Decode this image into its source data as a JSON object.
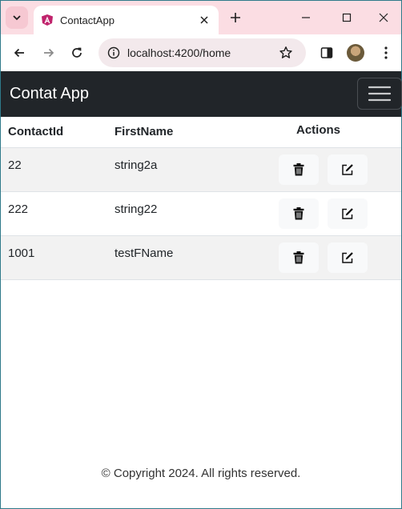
{
  "browser": {
    "tab_title": "ContactApp",
    "url": "localhost:4200/home"
  },
  "app": {
    "brand": "Contat App"
  },
  "table": {
    "headers": [
      "ContactId",
      "FirstName",
      "Actions"
    ],
    "rows": [
      {
        "id": "22",
        "first_name": "string2a"
      },
      {
        "id": "222",
        "first_name": "string22"
      },
      {
        "id": "1001",
        "first_name": "testFName"
      }
    ]
  },
  "icons": {
    "delete": "trash-icon",
    "edit": "pencil-square-icon"
  },
  "footer": {
    "text": "© Copyright 2024. All rights reserved."
  },
  "colors": {
    "navbar": "#212529",
    "tabstrip": "#fbdde3",
    "row_stripe": "#f2f2f2"
  }
}
